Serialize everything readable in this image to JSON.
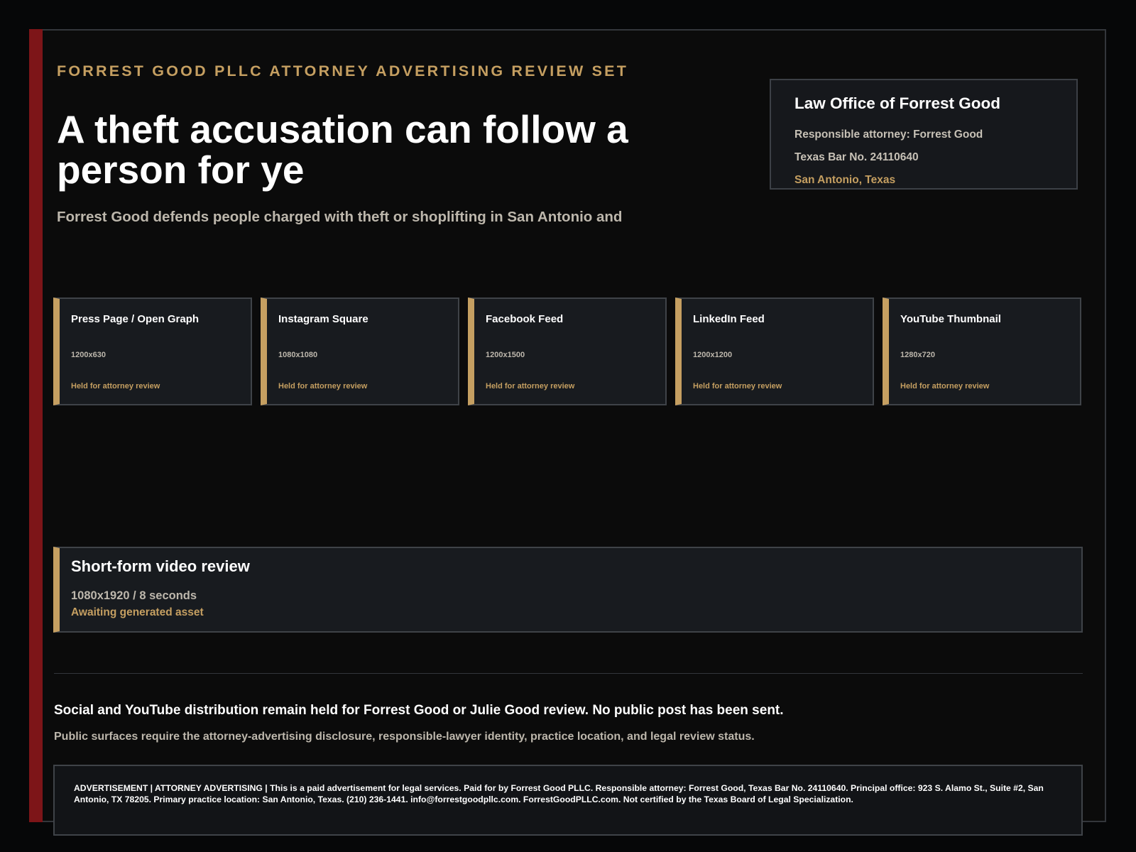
{
  "header": {
    "eyebrow": "FORREST GOOD PLLC ATTORNEY ADVERTISING REVIEW SET",
    "headline": "A theft accusation can follow a person for ye",
    "subhead": "Forrest Good defends people charged with theft or shoplifting in San Antonio and"
  },
  "office_card": {
    "name": "Law Office of Forrest Good",
    "responsible_attorney": "Responsible attorney: Forrest Good",
    "bar_number": "Texas Bar No. 24110640",
    "location": "San Antonio, Texas"
  },
  "formats": [
    {
      "title": "Press Page / Open Graph",
      "size": "1200x630",
      "status": "Held for attorney review"
    },
    {
      "title": "Instagram Square",
      "size": "1080x1080",
      "status": "Held for attorney review"
    },
    {
      "title": "Facebook Feed",
      "size": "1200x1500",
      "status": "Held for attorney review"
    },
    {
      "title": "LinkedIn Feed",
      "size": "1200x1200",
      "status": "Held for attorney review"
    },
    {
      "title": "YouTube Thumbnail",
      "size": "1280x720",
      "status": "Held for attorney review"
    }
  ],
  "video": {
    "title": "Short-form video review",
    "size": "1080x1920 / 8 seconds",
    "status": "Awaiting generated asset"
  },
  "footer": {
    "hold_notice": "Social and YouTube distribution remain held for Forrest Good or Julie Good review. No public post has been sent.",
    "requirements": "Public surfaces require the attorney-advertising disclosure, responsible-lawyer identity, practice location, and legal review status.",
    "disclosure": "ADVERTISEMENT | ATTORNEY ADVERTISING | This is a paid advertisement for legal services. Paid for by Forrest Good PLLC. Responsible attorney: Forrest Good, Texas Bar No. 24110640. Principal office: 923 S. Alamo St., Suite #2, San Antonio, TX 78205. Primary practice location: San Antonio, Texas. (210) 236-1441. info@forrestgoodpllc.com. ForrestGoodPLLC.com. Not certified by the Texas Board of Legal Specialization."
  },
  "colors": {
    "accent_gold": "#c59f61",
    "accent_red": "#7d1518",
    "background": "#0b0b0b",
    "card": "#181b1f"
  }
}
